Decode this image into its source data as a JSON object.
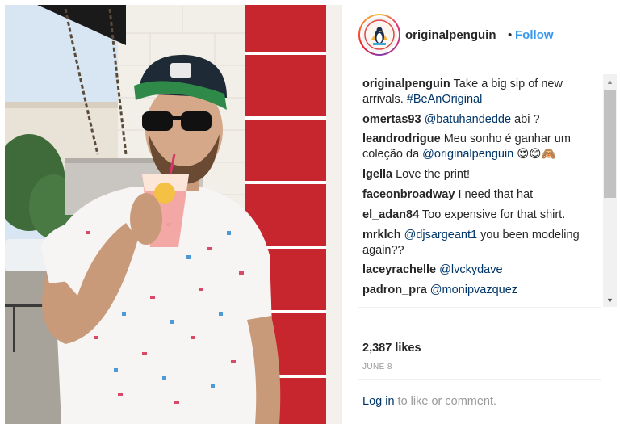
{
  "post": {
    "username": "originalpenguin",
    "follow_separator": "•",
    "follow_label": "Follow",
    "caption_user": "originalpenguin",
    "caption_text": "Take a big sip of new arrivals.",
    "caption_hashtag": "#BeAnOriginal",
    "likes": "2,387 likes",
    "date": "JUNE 8",
    "login_link": "Log in",
    "login_text": "to like or comment."
  },
  "comments": [
    {
      "user": "omertas93",
      "mention": "@batuhandedde",
      "text": "abi ?"
    },
    {
      "user": "leandrodrigue",
      "text_before": "Meu sonho é ganhar um coleção da",
      "mention": "@originalpenguin",
      "emoji": "😍😊🙈"
    },
    {
      "user": "lgella",
      "text": "Love the print!"
    },
    {
      "user": "faceonbroadway",
      "text": "I need that hat"
    },
    {
      "user": "el_adan84",
      "text": "Too expensive for that shirt."
    },
    {
      "user": "mrklch",
      "mention": "@djsargeant1",
      "text": "you been modeling again??"
    },
    {
      "user": "laceyrachelle",
      "mention": "@lvckydave"
    },
    {
      "user": "padron_pra",
      "mention": "@monipvazquez"
    }
  ],
  "icons": {
    "avatar": "penguin-logo-icon",
    "scroll_up": "scroll-up-arrow-icon",
    "scroll_down": "scroll-down-arrow-icon"
  },
  "colors": {
    "follow": "#3897f0",
    "link": "#003569",
    "muted": "#999999",
    "text": "#262626"
  }
}
